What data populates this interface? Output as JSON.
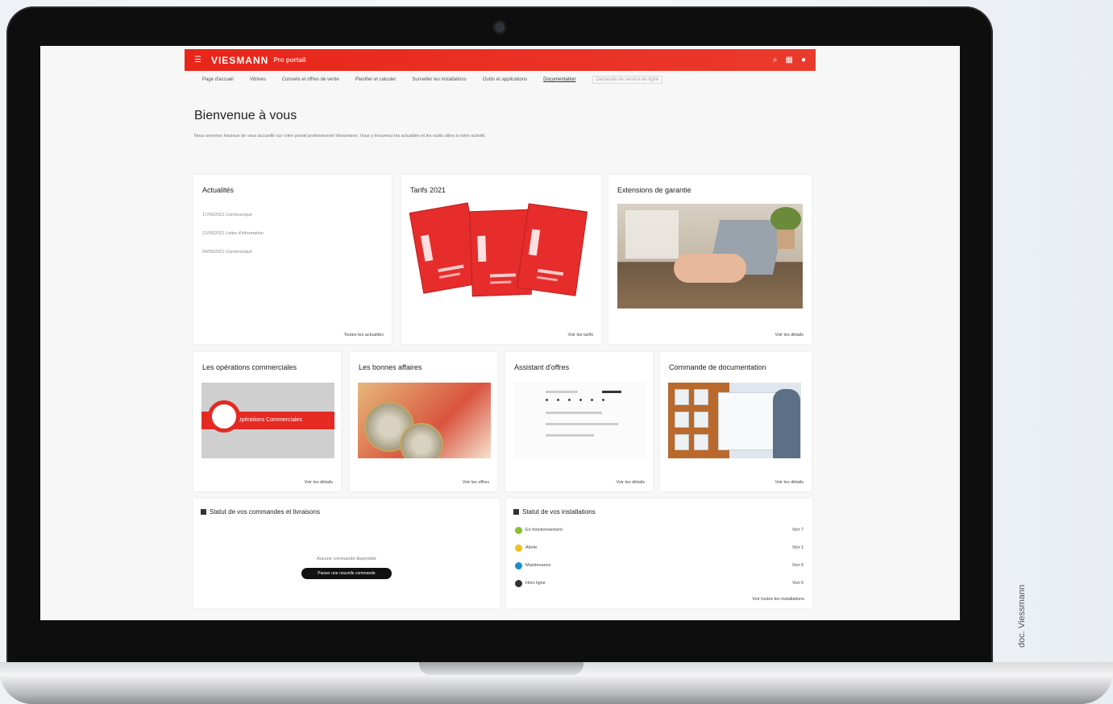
{
  "photo_credit": "doc. Viessmann",
  "topbar": {
    "menu_icon": "hamburger-icon",
    "brand": "VIESMANN",
    "portal_label": "Pro portail",
    "icons": [
      "search-icon",
      "grid-icon",
      "user-icon"
    ],
    "accent_color": "#e8251a"
  },
  "nav": {
    "items": [
      "Page d'accueil",
      "Vitrines",
      "Conseils et offres de vente",
      "Planifier et calculer",
      "Surveiller les installations",
      "Outils et applications",
      "Documentation",
      "Demande de service en ligne"
    ]
  },
  "welcome": {
    "title": "Bienvenue à vous",
    "intro": "Nous sommes heureux de vous accueillir sur votre portail professionnel Viessmann. Vous y trouverez les actualités et les outils utiles à votre activité."
  },
  "cards": {
    "actualites": {
      "title": "Actualités",
      "items": [
        "17/06/2021 Communiqué",
        "12/05/2021 Lettre d'information",
        "04/05/2021 Communiqué"
      ],
      "more": "Toutes les actualités"
    },
    "tarifs": {
      "title": "Tarifs 2021",
      "more": "Voir les tarifs"
    },
    "garantie": {
      "title": "Extensions de garantie",
      "more": "Voir les détails"
    },
    "operations": {
      "title": "Les opérations commerciales",
      "banner": "Opérations Commerciales",
      "more": "Voir les détails"
    },
    "affaires": {
      "title": "Les bonnes affaires",
      "more": "Voir les offres"
    },
    "assistant": {
      "title": "Assistant d'offres",
      "more": "Voir les détails"
    },
    "commande": {
      "title": "Commande de documentation",
      "more": "Voir les détails"
    }
  },
  "status_orders": {
    "icon": "truck-icon",
    "title": "Statut de vos commandes et livraisons",
    "empty_message": "Aucune commande disponible",
    "button": "Passer une nouvelle commande"
  },
  "status_installations": {
    "icon": "building-icon",
    "title": "Statut de vos installations",
    "rows": [
      {
        "label": "En fonctionnement",
        "count": "Voir 7",
        "color": "#8bbf2e"
      },
      {
        "label": "Alerte",
        "count": "Voir 1",
        "color": "#f2c01e"
      },
      {
        "label": "Maintenance",
        "count": "Voir 0",
        "color": "#1d8ec9"
      },
      {
        "label": "Hors ligne",
        "count": "Voir 0",
        "color": "#333333"
      }
    ],
    "more": "Voir toutes les installations"
  }
}
